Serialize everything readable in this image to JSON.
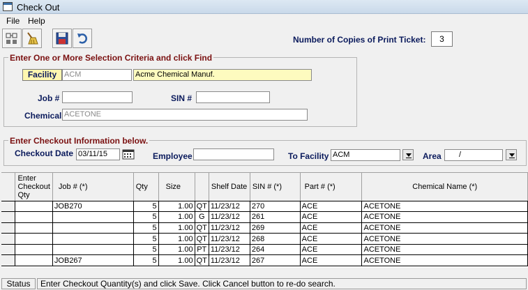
{
  "window": {
    "title": "Check Out"
  },
  "menu": {
    "items": [
      {
        "label": "File"
      },
      {
        "label": "Help"
      }
    ]
  },
  "toolbar": {
    "buttons": [
      "find-icon",
      "broom-icon",
      "save-icon",
      "undo-icon"
    ]
  },
  "copies": {
    "label": "Number of Copies of Print Ticket:",
    "value": "3"
  },
  "selection": {
    "legend": "Enter One or More Selection Criteria and click Find",
    "facility_label": "Facility",
    "facility_code": "ACM",
    "facility_name": "Acme Chemical Manuf.",
    "job_label": "Job #",
    "job_value": "",
    "sin_label": "SIN #",
    "sin_value": "",
    "chemical_label": "Chemical",
    "chemical_value": "ACETONE"
  },
  "checkout": {
    "legend": "Enter Checkout Information below.",
    "date_label": "Checkout Date",
    "date_value": "03/11/15",
    "employee_label": "Employee",
    "employee_value": "",
    "to_facility_label": "To Facility",
    "to_facility_value": "ACM",
    "area_label": "Area",
    "area_value": "/"
  },
  "grid": {
    "headers": {
      "enter_qty": "Enter Checkout Qty",
      "job": "Job # (*)",
      "qty": "Qty",
      "size": "Size",
      "unit": "",
      "shelf": "Shelf Date",
      "sin": "SIN # (*)",
      "part": "Part # (*)",
      "chem": "Chemical Name (*)"
    },
    "rows": [
      {
        "enter": "",
        "job": "JOB270",
        "qty": "5",
        "size": "1.00",
        "unit": "QT",
        "shelf": "11/23/12",
        "sin": "270",
        "part": "ACE",
        "chem": "ACETONE"
      },
      {
        "enter": "",
        "job": "",
        "qty": "5",
        "size": "1.00",
        "unit": "G",
        "shelf": "11/23/12",
        "sin": "261",
        "part": "ACE",
        "chem": "ACETONE"
      },
      {
        "enter": "",
        "job": "",
        "qty": "5",
        "size": "1.00",
        "unit": "QT",
        "shelf": "11/23/12",
        "sin": "269",
        "part": "ACE",
        "chem": "ACETONE"
      },
      {
        "enter": "",
        "job": "",
        "qty": "5",
        "size": "1.00",
        "unit": "QT",
        "shelf": "11/23/12",
        "sin": "268",
        "part": "ACE",
        "chem": "ACETONE"
      },
      {
        "enter": "",
        "job": "",
        "qty": "5",
        "size": "1.00",
        "unit": "PT",
        "shelf": "11/23/12",
        "sin": "264",
        "part": "ACE",
        "chem": "ACETONE"
      },
      {
        "enter": "",
        "job": "JOB267",
        "qty": "5",
        "size": "1.00",
        "unit": "QT",
        "shelf": "11/23/12",
        "sin": "267",
        "part": "ACE",
        "chem": "ACETONE"
      }
    ]
  },
  "status": {
    "label": "Status",
    "message": "Enter Checkout Quantity(s) and click Save. Click Cancel button to re-do search."
  }
}
